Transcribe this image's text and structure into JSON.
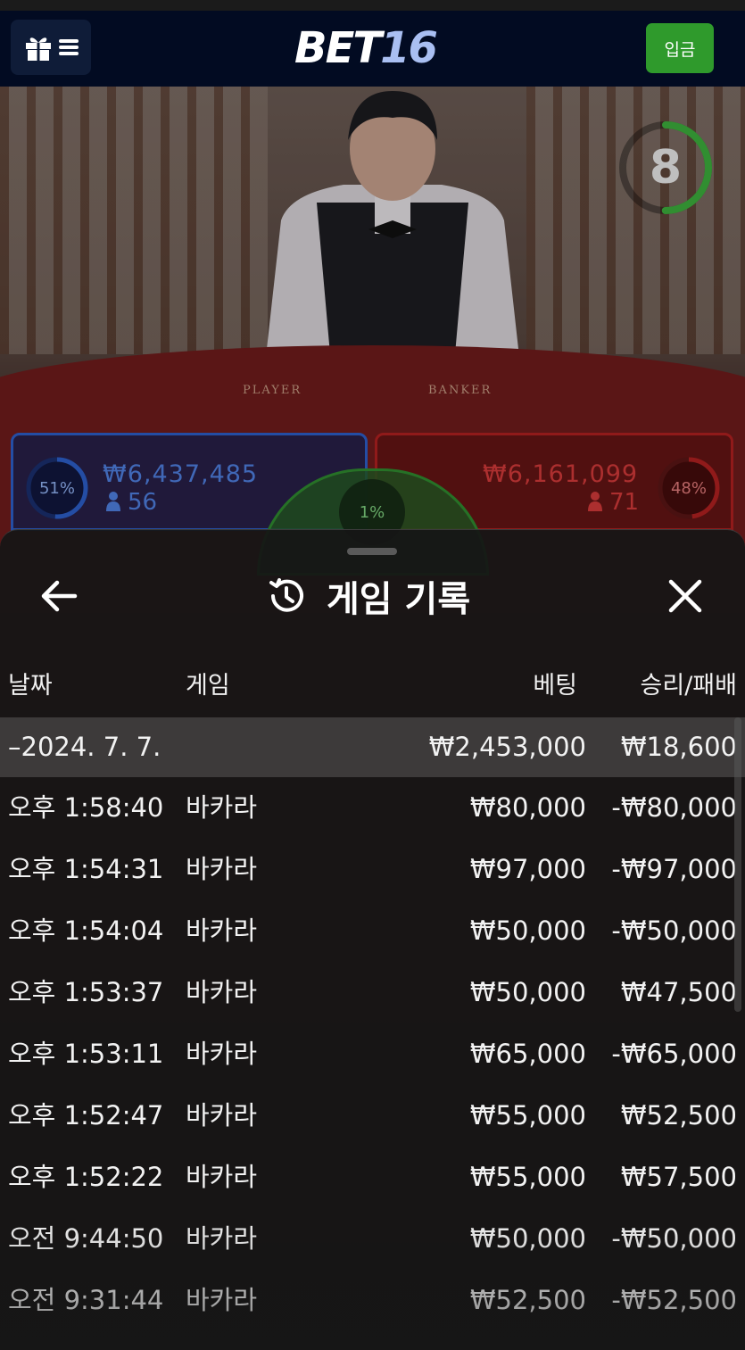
{
  "header": {
    "logo_part1": "BET",
    "logo_part2": "16",
    "deposit_label": "입금"
  },
  "game": {
    "countdown": "8",
    "countdown_fraction": 0.5,
    "table_player_label": "PLAYER",
    "table_banker_label": "BANKER",
    "player": {
      "percent": "51%",
      "percent_value": 0.51,
      "amount": "₩6,437,485",
      "count": "56",
      "color": "#2c5fc9"
    },
    "banker": {
      "percent": "48%",
      "percent_value": 0.48,
      "amount": "₩6,161,099",
      "count": "71",
      "color": "#b02020"
    },
    "tie": {
      "percent": "1%",
      "percent_value": 0.01,
      "color": "#2f8a2f"
    }
  },
  "history": {
    "title": "게임 기록",
    "columns": {
      "date": "날짜",
      "game": "게임",
      "bet": "베팅",
      "result": "승리/패배"
    },
    "date_group": {
      "date": "–2024. 7. 7.",
      "total_bet": "₩2,453,000",
      "total_result": "₩18,600"
    },
    "rows": [
      {
        "time": "오후 1:58:40",
        "game": "바카라",
        "bet": "₩80,000",
        "result": "-₩80,000"
      },
      {
        "time": "오후 1:54:31",
        "game": "바카라",
        "bet": "₩97,000",
        "result": "-₩97,000"
      },
      {
        "time": "오후 1:54:04",
        "game": "바카라",
        "bet": "₩50,000",
        "result": "-₩50,000"
      },
      {
        "time": "오후 1:53:37",
        "game": "바카라",
        "bet": "₩50,000",
        "result": "₩47,500"
      },
      {
        "time": "오후 1:53:11",
        "game": "바카라",
        "bet": "₩65,000",
        "result": "-₩65,000"
      },
      {
        "time": "오후 1:52:47",
        "game": "바카라",
        "bet": "₩55,000",
        "result": "₩52,500"
      },
      {
        "time": "오후 1:52:22",
        "game": "바카라",
        "bet": "₩55,000",
        "result": "₩57,500"
      },
      {
        "time": "오전 9:44:50",
        "game": "바카라",
        "bet": "₩50,000",
        "result": "-₩50,000"
      },
      {
        "time": "오전 9:31:44",
        "game": "바카라",
        "bet": "₩52,500",
        "result": "-₩52,500"
      }
    ]
  },
  "icons": {
    "menu": "gift-icon",
    "menu2": "hamburger-icon",
    "back": "arrow-left-icon",
    "history": "history-icon",
    "close": "close-icon",
    "person": "person-icon"
  }
}
